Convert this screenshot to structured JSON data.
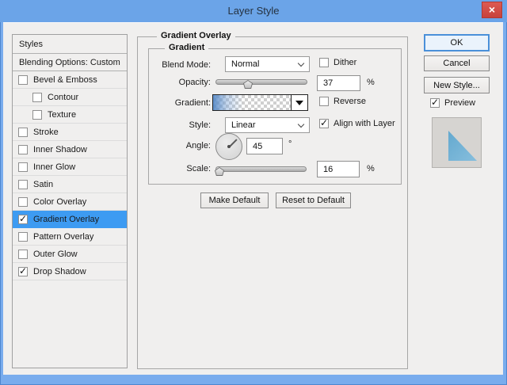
{
  "window": {
    "title": "Layer Style"
  },
  "colors": {
    "titlebar": "#6ba4e8",
    "window_border": "#79aced",
    "dialog_bg": "#f0efee",
    "selection_blue": "#3d9bf2",
    "close_red": "#c7423c",
    "gradient_blue": "#5689c7",
    "preview_triangle": "#6fb0d4"
  },
  "sidebar": {
    "header": "Styles",
    "blending_options": "Blending Options: Custom",
    "items": [
      {
        "label": "Bevel & Emboss",
        "checked": false,
        "indent": false,
        "selected": false
      },
      {
        "label": "Contour",
        "checked": false,
        "indent": true,
        "selected": false
      },
      {
        "label": "Texture",
        "checked": false,
        "indent": true,
        "selected": false
      },
      {
        "label": "Stroke",
        "checked": false,
        "indent": false,
        "selected": false
      },
      {
        "label": "Inner Shadow",
        "checked": false,
        "indent": false,
        "selected": false
      },
      {
        "label": "Inner Glow",
        "checked": false,
        "indent": false,
        "selected": false
      },
      {
        "label": "Satin",
        "checked": false,
        "indent": false,
        "selected": false
      },
      {
        "label": "Color Overlay",
        "checked": false,
        "indent": false,
        "selected": false
      },
      {
        "label": "Gradient Overlay",
        "checked": true,
        "indent": false,
        "selected": true
      },
      {
        "label": "Pattern Overlay",
        "checked": false,
        "indent": false,
        "selected": false
      },
      {
        "label": "Outer Glow",
        "checked": false,
        "indent": false,
        "selected": false
      },
      {
        "label": "Drop Shadow",
        "checked": true,
        "indent": false,
        "selected": false
      }
    ]
  },
  "panel": {
    "group_title": "Gradient Overlay",
    "subgroup_title": "Gradient",
    "blend_mode": {
      "label": "Blend Mode:",
      "value": "Normal"
    },
    "dither": {
      "label": "Dither",
      "checked": false
    },
    "opacity": {
      "label": "Opacity:",
      "value": "37",
      "unit": "%",
      "percent_position": 35
    },
    "gradient": {
      "label": "Gradient:"
    },
    "reverse": {
      "label": "Reverse",
      "checked": false
    },
    "style": {
      "label": "Style:",
      "value": "Linear"
    },
    "align": {
      "label": "Align with Layer",
      "checked": true
    },
    "angle": {
      "label": "Angle:",
      "value": "45",
      "unit": "°"
    },
    "scale": {
      "label": "Scale:",
      "value": "16",
      "unit": "%",
      "percent_position": 4
    },
    "buttons": {
      "make_default": "Make Default",
      "reset_default": "Reset to Default"
    }
  },
  "actions": {
    "ok": "OK",
    "cancel": "Cancel",
    "new_style": "New Style...",
    "preview": {
      "label": "Preview",
      "checked": true
    }
  }
}
